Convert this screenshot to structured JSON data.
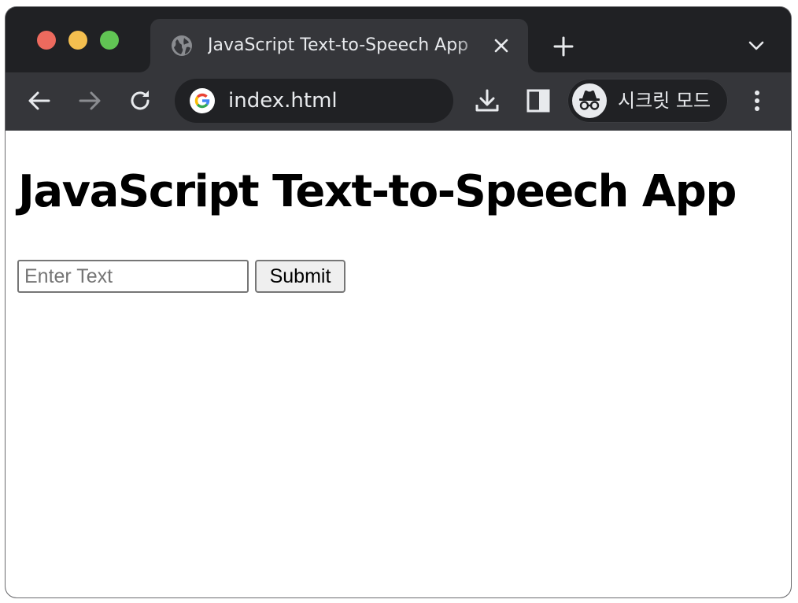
{
  "browser": {
    "tab": {
      "title": "JavaScript Text-to-Speech App",
      "favicon": "globe-icon"
    },
    "address_bar": {
      "url": "index.html"
    },
    "profile": {
      "label": "시크릿 모드",
      "icon": "incognito-icon"
    },
    "colors": {
      "frame": "#202124",
      "toolbar": "#35363a",
      "text": "#e8eaed"
    }
  },
  "page": {
    "heading": "JavaScript Text-to-Speech App",
    "input": {
      "placeholder": "Enter Text",
      "value": ""
    },
    "submit_label": "Submit"
  }
}
